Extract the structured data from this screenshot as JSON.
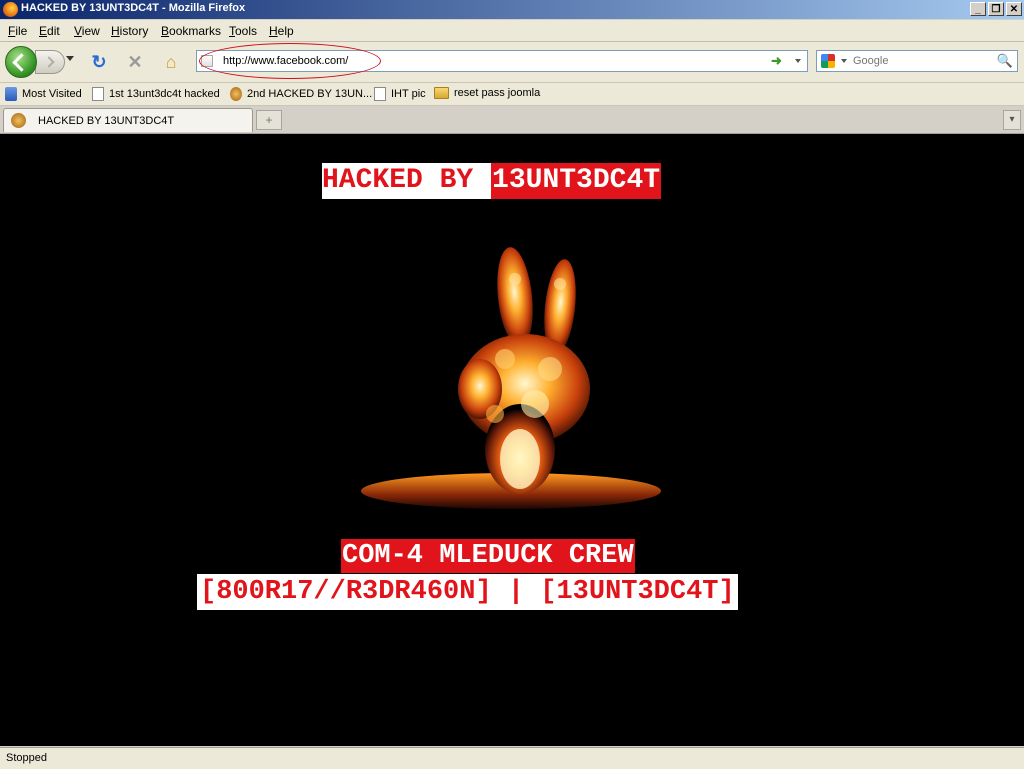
{
  "window": {
    "title": "HACKED BY 13UNT3DC4T - Mozilla Firefox",
    "controls": [
      "_",
      "❐",
      "✕"
    ]
  },
  "menu": [
    {
      "label": "File",
      "accel": "F",
      "rest": "ile"
    },
    {
      "label": "Edit",
      "accel": "E",
      "rest": "dit"
    },
    {
      "label": "View",
      "accel": "V",
      "rest": "iew"
    },
    {
      "label": "History",
      "accel": "H",
      "rest": "istory"
    },
    {
      "label": "Bookmarks",
      "accel": "B",
      "rest": "ookmarks"
    },
    {
      "label": "Tools",
      "accel": "T",
      "rest": "ools"
    },
    {
      "label": "Help",
      "accel": "H",
      "rest": "elp"
    }
  ],
  "toolbar": {
    "reload_glyph": "↻",
    "stop_glyph": "✕",
    "home_glyph": "⌂",
    "go_glyph": "➜"
  },
  "urlbar": {
    "value": "http://www.facebook.com/",
    "annotation_color": "#d0101a"
  },
  "search": {
    "placeholder": "Google",
    "engine_icon": "google-icon",
    "magnifier_glyph": "🔍"
  },
  "bookmarks": [
    {
      "label": "Most Visited",
      "icon": "most-visited-icon"
    },
    {
      "label": "1st 13unt3dc4t hacked",
      "icon": "page-icon"
    },
    {
      "label": "2nd HACKED BY 13UN...",
      "icon": "favicon-icon"
    },
    {
      "label": "IHT pic",
      "icon": "page-icon"
    },
    {
      "label": "reset pass joomla",
      "icon": "folder-icon"
    }
  ],
  "tabs": [
    {
      "title": "HACKED BY 13UNT3DC4T",
      "active": true
    }
  ],
  "tabbar": {
    "new_tab_glyph": "+",
    "list_glyph": "▾"
  },
  "page": {
    "headline_white": "HACKED BY ",
    "headline_red": "13UNT3DC4T",
    "crew": "COM-4 MLEDUCK CREW",
    "members": "[800R17//R3DR460N] | [13UNT3DC4T]",
    "image": "fire-peace-hand-image",
    "colors": {
      "background": "#000000",
      "accent_red": "#e0141a",
      "white": "#ffffff"
    }
  },
  "status": {
    "text": "Stopped"
  }
}
